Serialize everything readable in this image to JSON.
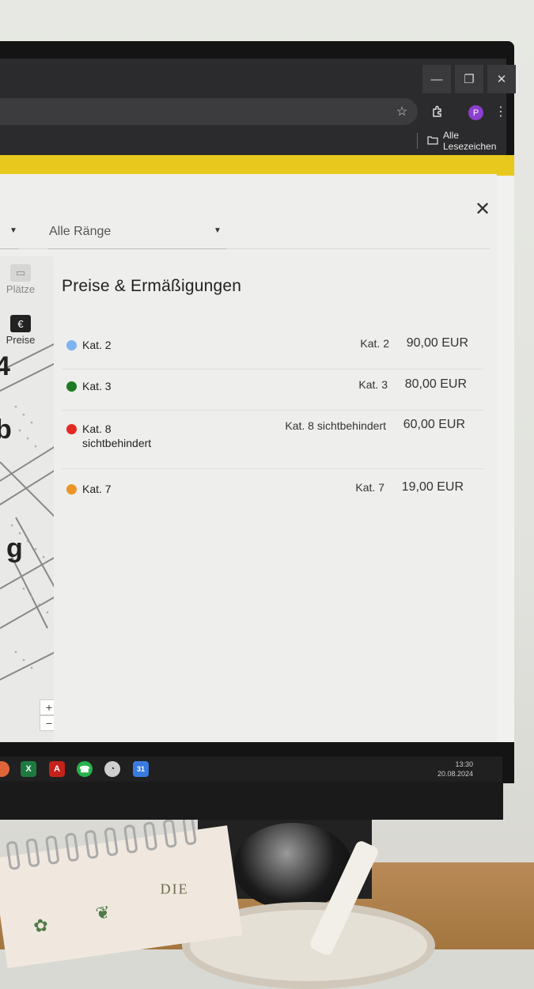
{
  "browser": {
    "profile_initial": "P",
    "bookmarks_label": "Alle Lesezeichen"
  },
  "filters": {
    "rank_select": "Alle Ränge"
  },
  "sidebar": {
    "tabs": [
      {
        "label": "Plätze",
        "icon": "seats-icon"
      },
      {
        "label": "Preise",
        "icon": "euro-icon"
      }
    ]
  },
  "map": {
    "letters": [
      "4",
      "b",
      "g"
    ],
    "zoom_in": "+",
    "zoom_out": "−"
  },
  "prices": {
    "title": "Preise & Ermäßigungen",
    "items": [
      {
        "category": "Kat. 2",
        "category_line2": "",
        "color": "#7fb2f0",
        "detail": "Kat. 2",
        "price": "90,00 EUR"
      },
      {
        "category": "Kat. 3",
        "category_line2": "",
        "color": "#1e7a22",
        "detail": "Kat. 3",
        "price": "80,00 EUR"
      },
      {
        "category": "Kat. 8",
        "category_line2": "sichtbehindert",
        "color": "#e22a22",
        "detail": "Kat. 8 sichtbehindert",
        "price": "60,00 EUR"
      },
      {
        "category": "Kat. 7",
        "category_line2": "",
        "color": "#ec9428",
        "detail": "Kat. 7",
        "price": "19,00 EUR"
      }
    ]
  },
  "taskbar": {
    "time": "13:30",
    "date": "20.08.2024",
    "apps": [
      "excel-icon",
      "acrobat-icon",
      "whatsapp-icon",
      "clock-icon",
      "calendar-icon"
    ],
    "calendar_day": "31"
  },
  "desk": {
    "notebook_text": "DIE"
  }
}
